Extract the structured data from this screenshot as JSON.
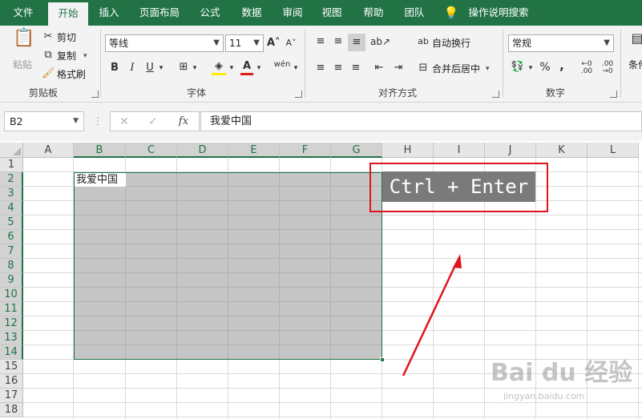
{
  "menu": {
    "tabs": [
      "文件",
      "开始",
      "插入",
      "页面布局",
      "公式",
      "数据",
      "审阅",
      "视图",
      "帮助",
      "团队"
    ],
    "active": "开始",
    "tell_me": "操作说明搜索",
    "tell_me_icon": "lightbulb-icon"
  },
  "ribbon": {
    "clipboard": {
      "paste": "粘贴",
      "cut": "剪切",
      "copy": "复制",
      "format_painter": "格式刷",
      "group_label": "剪贴板"
    },
    "font": {
      "font_name": "等线",
      "font_size": "11",
      "bold": "B",
      "italic": "I",
      "underline": "U",
      "wen": "wén",
      "group_label": "字体"
    },
    "alignment": {
      "wrap_text": "自动换行",
      "merge_center": "合并后居中",
      "group_label": "对齐方式"
    },
    "number": {
      "format": "常规",
      "percent": "%",
      "comma": ",",
      "group_label": "数字"
    },
    "styles": {
      "conditional": "条件"
    }
  },
  "formula_bar": {
    "name_box": "B2",
    "fx": "fx",
    "content": "我爱中国"
  },
  "sheet": {
    "columns": [
      "A",
      "B",
      "C",
      "D",
      "E",
      "F",
      "G",
      "H",
      "I",
      "J",
      "K",
      "L"
    ],
    "rows": [
      "1",
      "2",
      "3",
      "4",
      "5",
      "6",
      "7",
      "8",
      "9",
      "10",
      "11",
      "12",
      "13",
      "14",
      "15",
      "16",
      "17",
      "18"
    ],
    "selected_columns": [
      "B",
      "C",
      "D",
      "E",
      "F",
      "G"
    ],
    "selected_rows": [
      "2",
      "3",
      "4",
      "5",
      "6",
      "7",
      "8",
      "9",
      "10",
      "11",
      "12",
      "13",
      "14"
    ],
    "cell_B2": "我爱中国",
    "selection_color": "#c6c6c6",
    "accent": "#217346"
  },
  "annotation": {
    "shortcut": "Ctrl + Enter",
    "border_color": "#e0141e",
    "arrow_color": "#e0141e"
  },
  "watermark": {
    "text": "Bai du 经验",
    "sub": "jingyan.baidu.com"
  }
}
